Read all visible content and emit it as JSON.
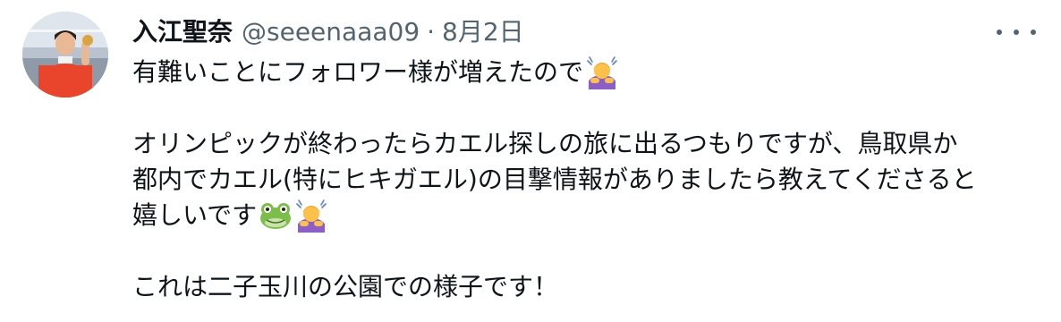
{
  "tweet": {
    "author": {
      "display_name": "入江聖奈",
      "handle": "@seeenaaa09",
      "separator": "·",
      "date": "8月2日"
    },
    "more_icon": "more-options-icon",
    "lines": {
      "l1": "有難いことにフォロワー様が増えたので",
      "l2": "オリンピックが終わったらカエル探しの旅に出るつもりですが、鳥取県か",
      "l3": "都内でカエル(特にヒキガエル)の目撃情報がありましたら教えてくださると",
      "l4": "嬉しいです",
      "l5": "これは二子玉川の公園での様子です！"
    },
    "emojis": {
      "bowing": "person-bowing-emoji",
      "frog": "frog-face-emoji"
    }
  },
  "colors": {
    "text": "#0f1419",
    "secondary": "#536471",
    "background": "#ffffff"
  }
}
